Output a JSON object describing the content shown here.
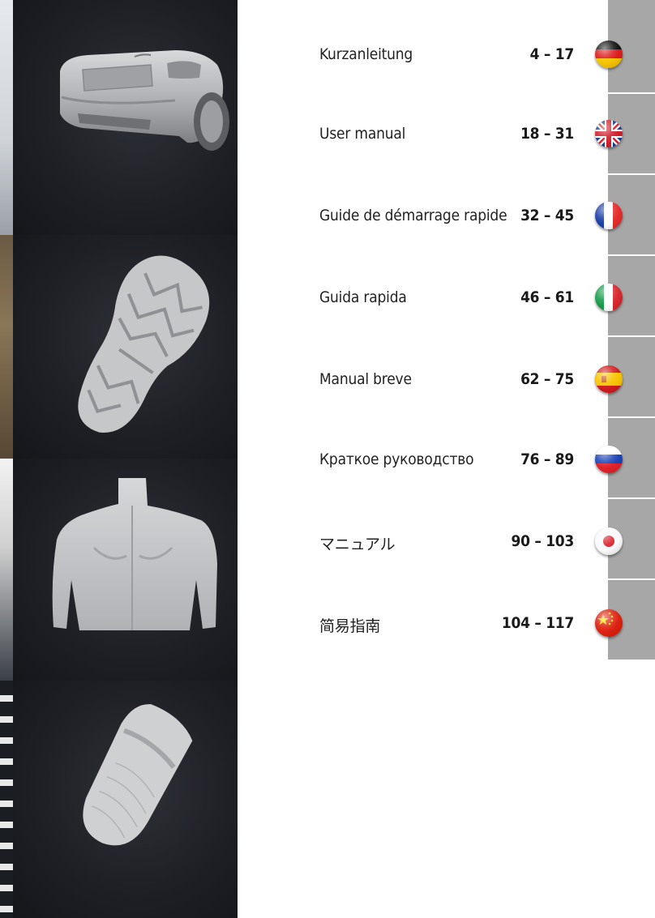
{
  "toc": [
    {
      "title": "Kurzanleitung",
      "pages": "4 – 17",
      "flag": "flag-germany"
    },
    {
      "title": "User manual",
      "pages": "18 – 31",
      "flag": "flag-united-kingdom"
    },
    {
      "title": "Guide de démarrage rapide",
      "pages": "32 – 45",
      "flag": "flag-france"
    },
    {
      "title": "Guida rapida",
      "pages": "46 – 61",
      "flag": "flag-italy"
    },
    {
      "title": "Manual breve",
      "pages": "62 – 75",
      "flag": "flag-spain"
    },
    {
      "title": "Краткое руководство",
      "pages": "76 – 89",
      "flag": "flag-russia"
    },
    {
      "title": "マニュアル",
      "pages": "90 – 103",
      "flag": "flag-japan"
    },
    {
      "title": "简易指南",
      "pages": "104 – 117",
      "flag": "flag-china"
    }
  ],
  "images": [
    {
      "subject": "3d-scan-car-rear"
    },
    {
      "subject": "3d-scan-shoe-sole"
    },
    {
      "subject": "3d-scan-human-back"
    },
    {
      "subject": "3d-scan-finger"
    }
  ],
  "colors": {
    "tab_grey": "#a7a7a7",
    "panel_dark": "#1e2026",
    "scan_grey": "#c9cacc"
  }
}
